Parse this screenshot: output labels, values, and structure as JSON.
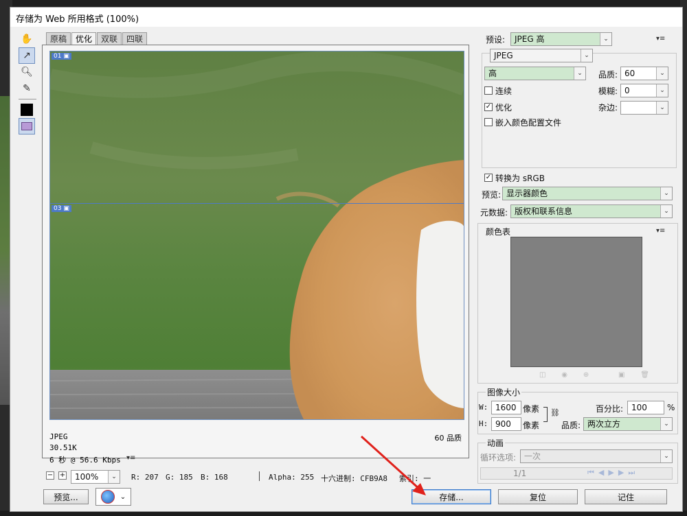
{
  "dialog": {
    "title": "存储为 Web 所用格式 (100%)"
  },
  "tabs": [
    "原稿",
    "优化",
    "双联",
    "四联"
  ],
  "image": {
    "slice_top": "01",
    "slice_mid": "03",
    "info_format": "JPEG",
    "info_size": "30.51K",
    "info_time": "6 秒 @ 56.6 Kbps",
    "info_quality": "60 品质"
  },
  "statusbar": {
    "zoom": "100%",
    "r": "R: 207",
    "g": "G: 185",
    "b": "B: 168",
    "alpha": "Alpha: 255",
    "hex": "十六进制: CFB9A8",
    "index": "索引: 一"
  },
  "settings": {
    "preset_label": "预设:",
    "preset_value": "JPEG 高",
    "format": "JPEG",
    "quality_preset": "高",
    "quality_label": "品质:",
    "quality_value": "60",
    "blur_label": "模糊:",
    "blur_value": "0",
    "matte_label": "杂边:",
    "progressive": "连续",
    "optimized": "优化",
    "embed_profile": "嵌入颜色配置文件",
    "convert_srgb": "转换为 sRGB",
    "preview_label": "预览:",
    "preview_value": "显示器颜色",
    "metadata_label": "元数据:",
    "metadata_value": "版权和联系信息"
  },
  "color_table": {
    "title": "颜色表"
  },
  "image_size": {
    "title": "图像大小",
    "w_label": "W:",
    "w_value": "1600",
    "h_label": "H:",
    "h_value": "900",
    "unit": "像素",
    "percent_label": "百分比:",
    "percent_value": "100",
    "percent_unit": "%",
    "quality_label": "品质:",
    "quality_value": "两次立方"
  },
  "animation": {
    "title": "动画",
    "loop_label": "循环选项:",
    "loop_value": "一次",
    "frame": "1/1"
  },
  "buttons": {
    "preview": "预览...",
    "save": "存储...",
    "reset": "复位",
    "remember": "记住"
  }
}
